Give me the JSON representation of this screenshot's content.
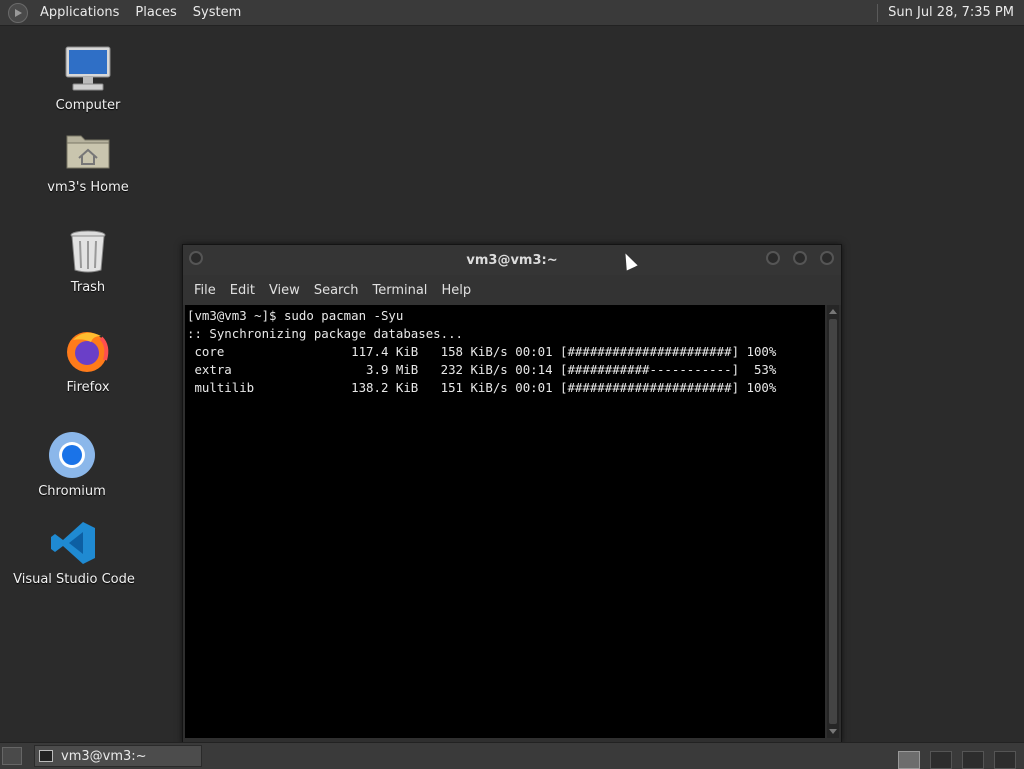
{
  "top_panel": {
    "menus": [
      "Applications",
      "Places",
      "System"
    ],
    "clock": "Sun Jul 28,  7:35 PM"
  },
  "desktop_icons": [
    {
      "label": "Computer",
      "icon": "computer-icon"
    },
    {
      "label": "vm3's Home",
      "icon": "home-folder-icon"
    },
    {
      "label": "Trash",
      "icon": "trash-icon"
    },
    {
      "label": "Firefox",
      "icon": "firefox-icon"
    },
    {
      "label": "Chromium",
      "icon": "chromium-icon"
    },
    {
      "label": "Visual Studio Code",
      "icon": "vscode-icon"
    }
  ],
  "terminal": {
    "title": "vm3@vm3:~",
    "menu": [
      "File",
      "Edit",
      "View",
      "Search",
      "Terminal",
      "Help"
    ],
    "lines": [
      "[vm3@vm3 ~]$ sudo pacman -Syu",
      ":: Synchronizing package databases...",
      " core                 117.4 KiB   158 KiB/s 00:01 [######################] 100%",
      " extra                  3.9 MiB   232 KiB/s 00:14 [###########-----------]  53%",
      " multilib             138.2 KiB   151 KiB/s 00:01 [######################] 100%"
    ]
  },
  "taskbar": {
    "task_label": "vm3@vm3:~"
  },
  "colors": {
    "desktop": "#2b2b2b",
    "panel": "#3a3a3a",
    "terminal_bg": "#000000",
    "terminal_fg": "#e8e8e8"
  }
}
